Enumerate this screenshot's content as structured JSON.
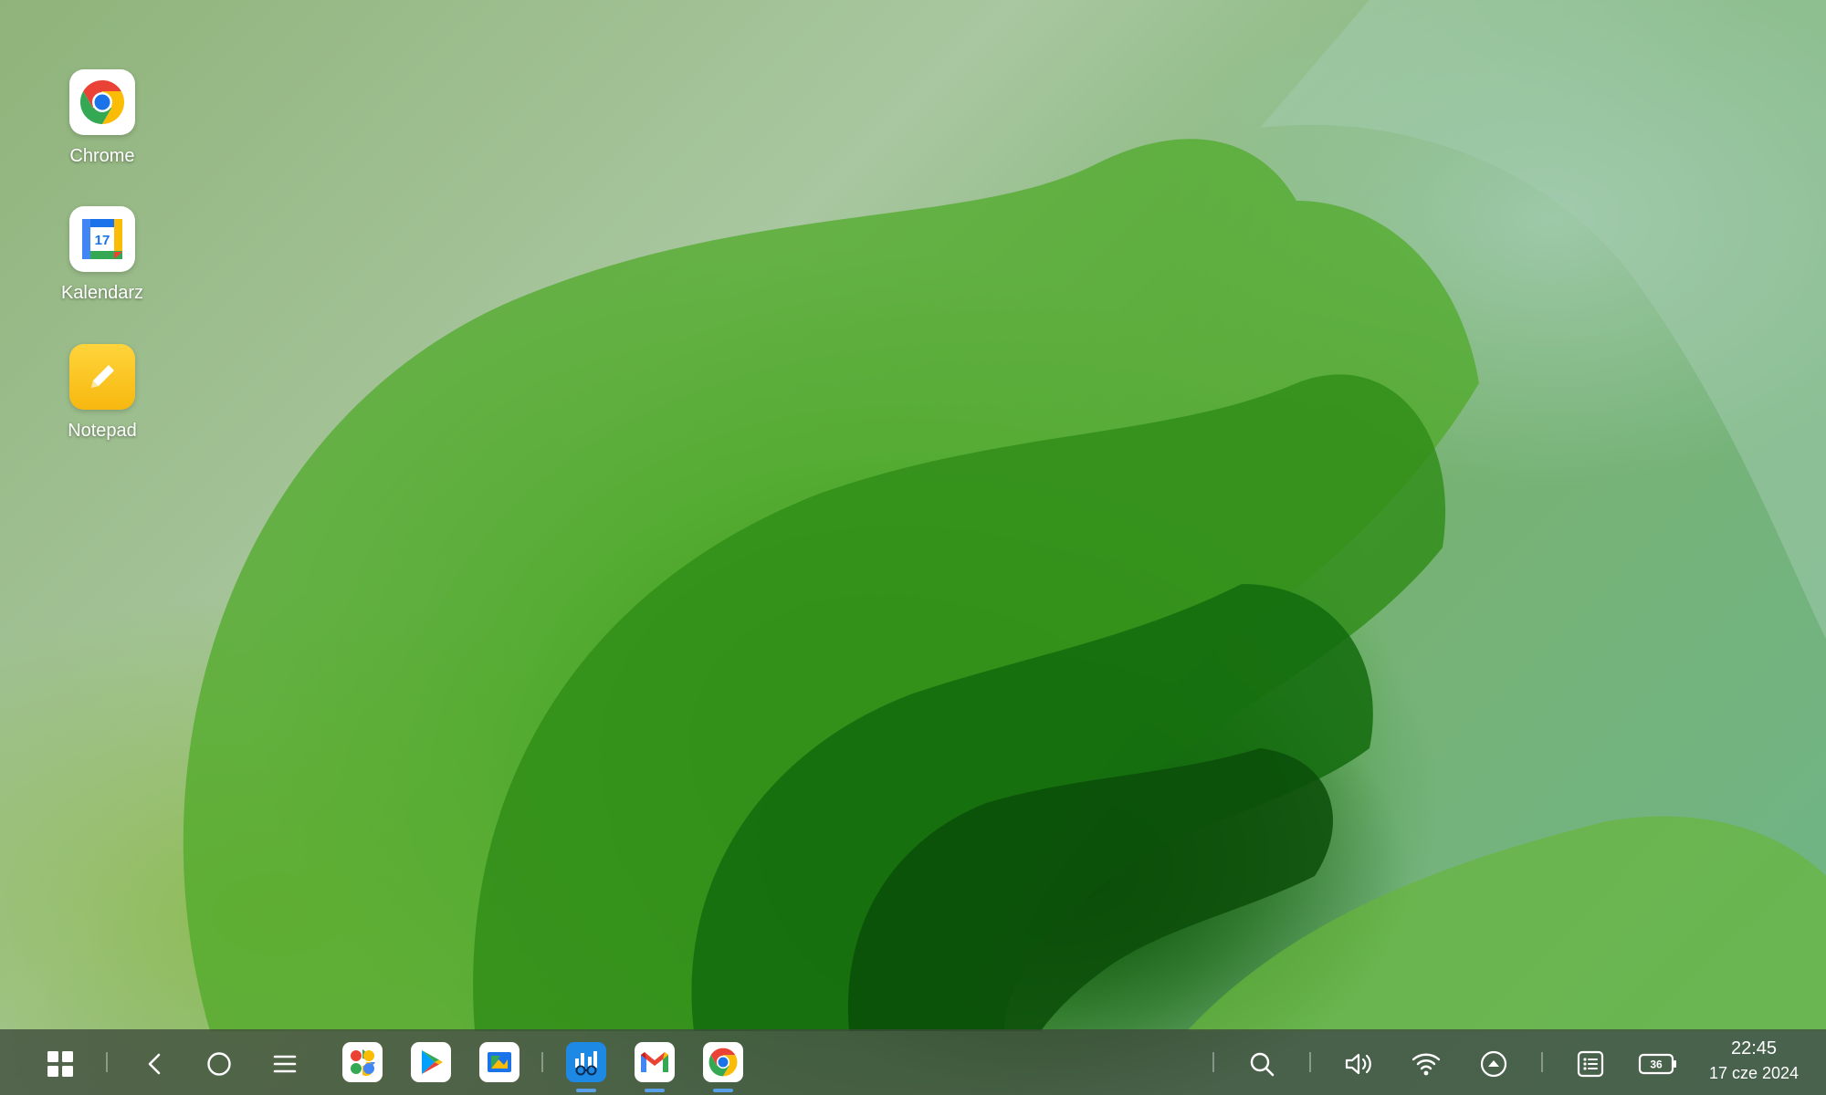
{
  "desktop": {
    "icons": [
      {
        "label": "Chrome"
      },
      {
        "label": "Kalendarz",
        "day": "17"
      },
      {
        "label": "Notepad"
      }
    ]
  },
  "taskbar": {
    "battery_level": "36",
    "time": "22:45",
    "date": "17 cze 2024"
  },
  "colors": {
    "accent_running": "#5aa0e8",
    "notepad_yellow": "#f9c21b"
  }
}
